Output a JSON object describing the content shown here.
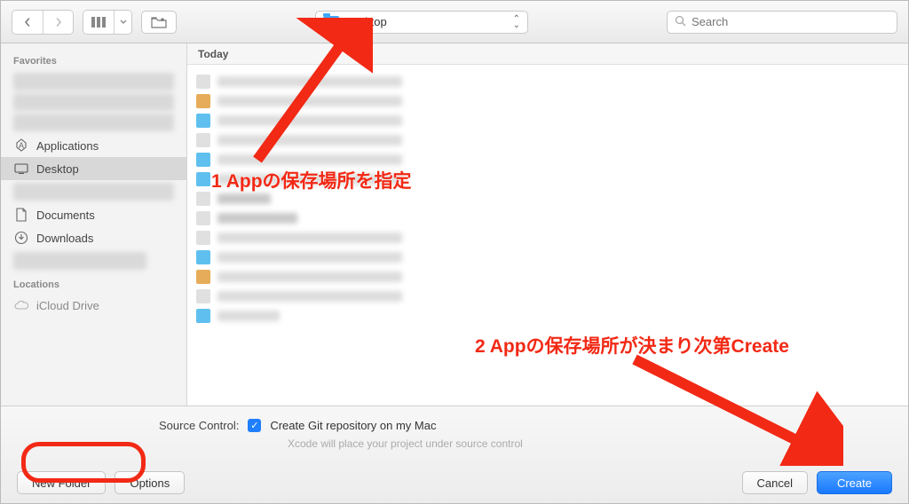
{
  "toolbar": {
    "location_label": "Desktop",
    "search_placeholder": "Search"
  },
  "sidebar": {
    "favorites_heading": "Favorites",
    "locations_heading": "Locations",
    "items": {
      "applications": "Applications",
      "desktop": "Desktop",
      "documents": "Documents",
      "downloads": "Downloads",
      "icloud": "iCloud Drive"
    }
  },
  "content": {
    "column_header": "Today"
  },
  "source_control": {
    "label": "Source Control:",
    "checkbox_label": "Create Git repository on my Mac",
    "help_text": "Xcode will place your project under source control"
  },
  "buttons": {
    "new_folder": "New Folder",
    "options": "Options",
    "cancel": "Cancel",
    "create": "Create"
  },
  "annotations": {
    "step1": "1 Appの保存場所を指定",
    "step2": "2 Appの保存場所が決まり次第Create"
  },
  "colors": {
    "accent": "#1978ff",
    "annotation": "#f22915"
  }
}
